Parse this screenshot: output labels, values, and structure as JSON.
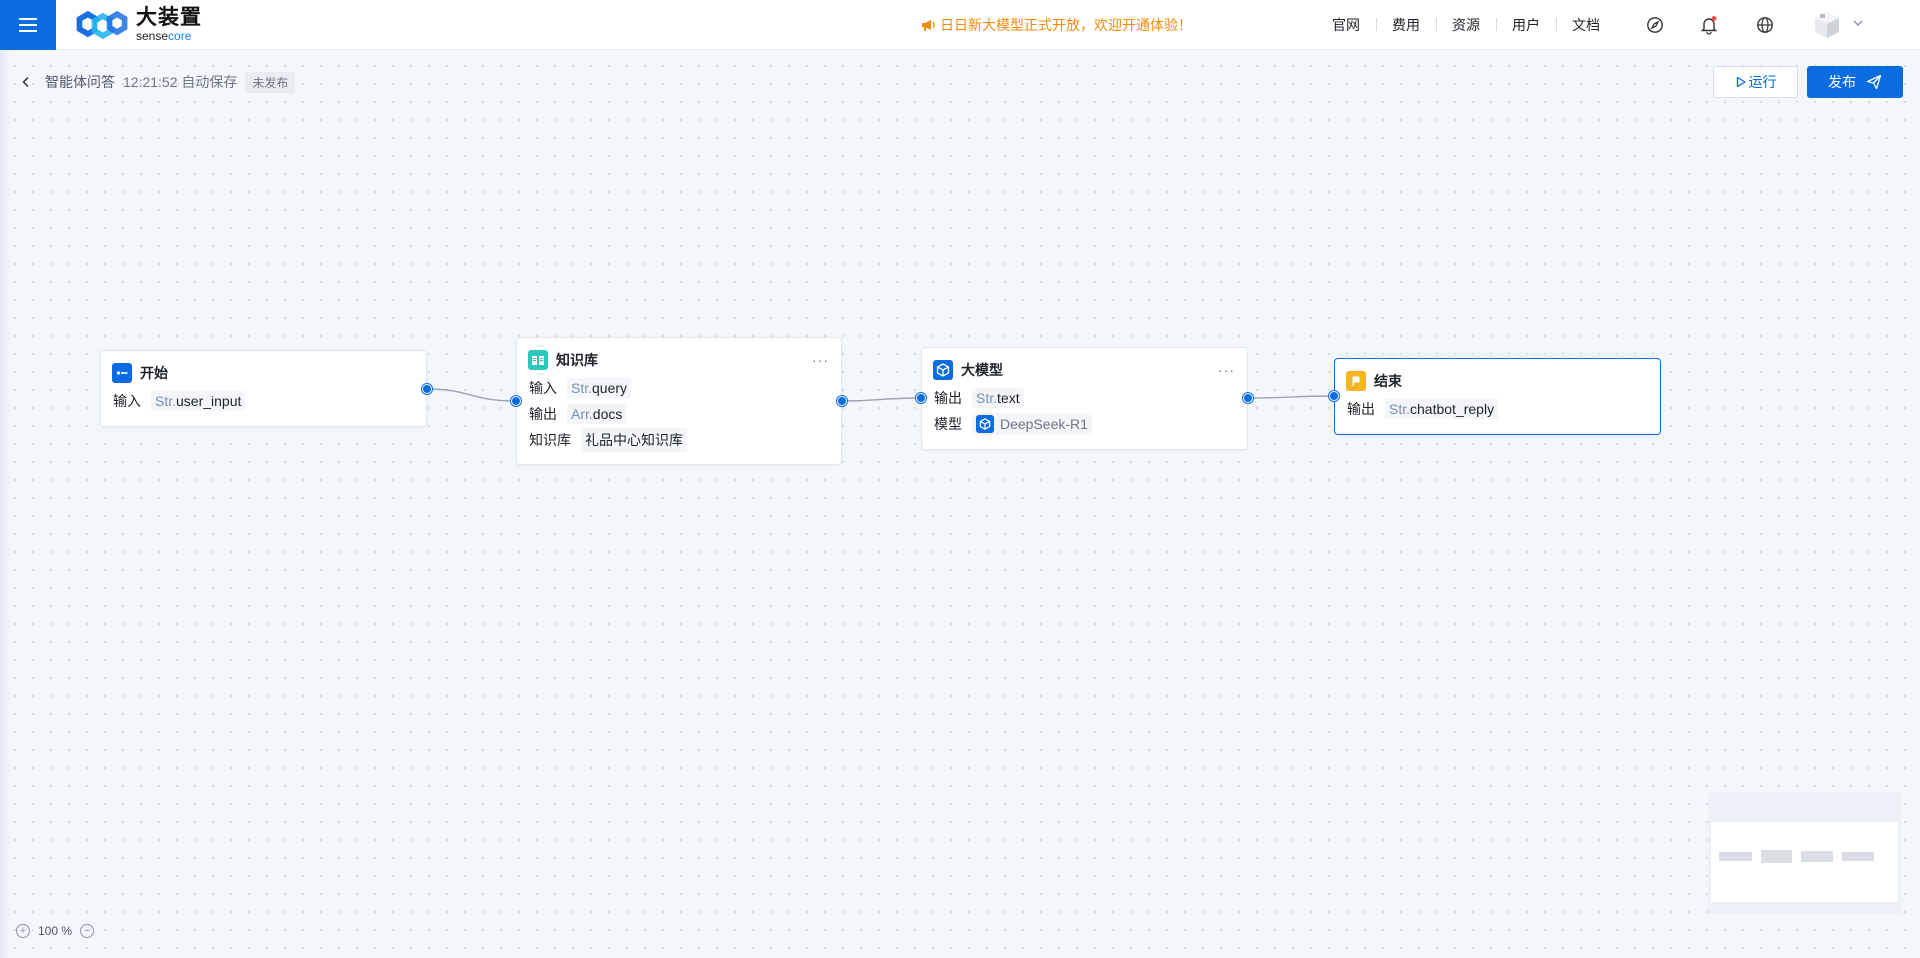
{
  "topbar": {
    "logo": {
      "cn": "大装置",
      "en_a": "sense",
      "en_b": "core"
    },
    "announcement": "日日新大模型正式开放，欢迎开通体验！",
    "nav": [
      "官网",
      "费用",
      "资源",
      "用户",
      "文档"
    ],
    "icons": [
      "compass-icon",
      "bell-icon",
      "globe-icon"
    ]
  },
  "workflow": {
    "name": "智能体问答",
    "save_time": "12:21:52",
    "save_label": "自动保存",
    "status": "未发布",
    "run_label": "运行",
    "publish_label": "发布"
  },
  "nodes": {
    "start": {
      "title": "开始",
      "rows": [
        {
          "label": "输入",
          "type": "Str.",
          "name": "user_input"
        }
      ]
    },
    "knowledge": {
      "title": "知识库",
      "rows": [
        {
          "label": "输入",
          "type": "Str.",
          "name": "query"
        },
        {
          "label": "输出",
          "type": "Arr.",
          "name": "docs"
        }
      ],
      "kb_label": "知识库",
      "kb_value": "礼品中心知识库"
    },
    "llm": {
      "title": "大模型",
      "rows": [
        {
          "label": "输出",
          "type": "Str.",
          "name": "text"
        }
      ],
      "model_label": "模型",
      "model_value": "DeepSeek-R1"
    },
    "end": {
      "title": "结束",
      "rows": [
        {
          "label": "输出",
          "type": "Str.",
          "name": "chatbot_reply"
        }
      ]
    }
  },
  "zoom": {
    "value": "100 %"
  },
  "colors": {
    "primary": "#0a6cde",
    "announce": "#f38a0b",
    "end_icon": "#f5b521",
    "kb_icon": "#2ec7c0"
  }
}
